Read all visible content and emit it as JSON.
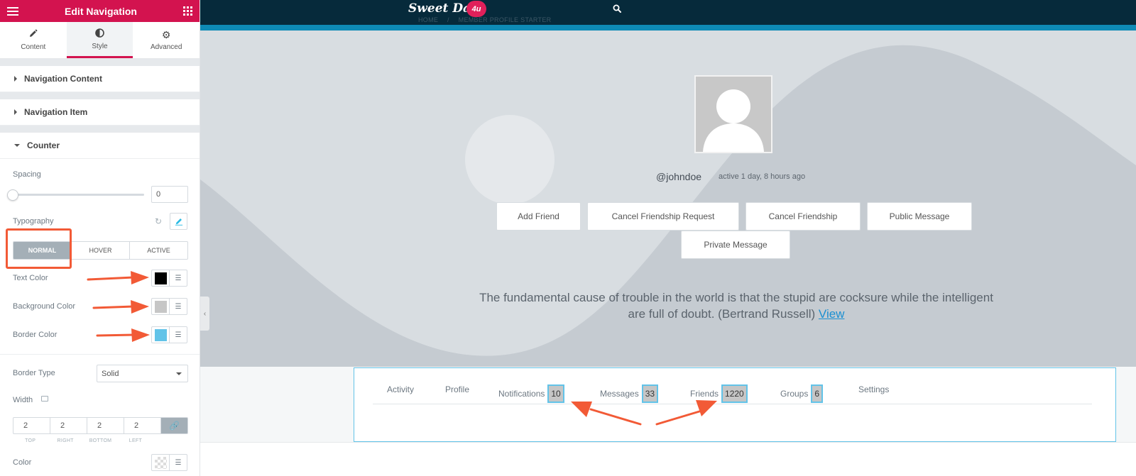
{
  "editor": {
    "title": "Edit Navigation",
    "tabs": [
      {
        "label": "Content",
        "icon": "pencil-icon"
      },
      {
        "label": "Style",
        "icon": "contrast-icon"
      },
      {
        "label": "Advanced",
        "icon": "gear-icon"
      }
    ],
    "active_tab": "Style",
    "sections": [
      {
        "label": "Navigation Content",
        "expanded": false
      },
      {
        "label": "Navigation Item",
        "expanded": false
      },
      {
        "label": "Counter",
        "expanded": true
      }
    ],
    "counter": {
      "spacing_label": "Spacing",
      "spacing_value": "0",
      "typography_label": "Typography",
      "state_tabs": [
        "NORMAL",
        "HOVER",
        "ACTIVE"
      ],
      "active_state": "NORMAL",
      "text_color_label": "Text Color",
      "text_color": "#000000",
      "background_color_label": "Background Color",
      "background_color": "#c6c6c6",
      "border_color_label": "Border Color",
      "border_color": "#62c3e8",
      "border_type_label": "Border Type",
      "border_type_value": "Solid",
      "width_label": "Width",
      "width_values": [
        "2",
        "2",
        "2",
        "2"
      ],
      "width_sublabels": [
        "TOP",
        "RIGHT",
        "BOTTOM",
        "LEFT"
      ],
      "color_label": "Color"
    }
  },
  "site": {
    "logo_text": "Sweet Date",
    "logo_badge": "4u",
    "breadcrumb": [
      "HOME",
      "/",
      "MEMBER PROFILE STARTER"
    ],
    "username": "@johndoe",
    "activity": "active 1 day, 8 hours ago",
    "buttons": [
      "Add Friend",
      "Cancel Friendship Request",
      "Cancel Friendship",
      "Public Message",
      "Private Message"
    ],
    "quote": "The fundamental cause of trouble in the world is that the stupid are cocksure while the intelligent are full of doubt. (Bertrand Russell)",
    "quote_link": "View",
    "nav": [
      {
        "label": "Activity",
        "count": null
      },
      {
        "label": "Profile",
        "count": null
      },
      {
        "label": "Notifications",
        "count": "10"
      },
      {
        "label": "Messages",
        "count": "33"
      },
      {
        "label": "Friends",
        "count": "1220"
      },
      {
        "label": "Groups",
        "count": "6"
      },
      {
        "label": "Settings",
        "count": null
      }
    ]
  },
  "colors": {
    "brand": "#d3134f",
    "topbar": "#062a3b",
    "accent_stripe": "#0e8ab5",
    "annotation": "#f25a36"
  }
}
